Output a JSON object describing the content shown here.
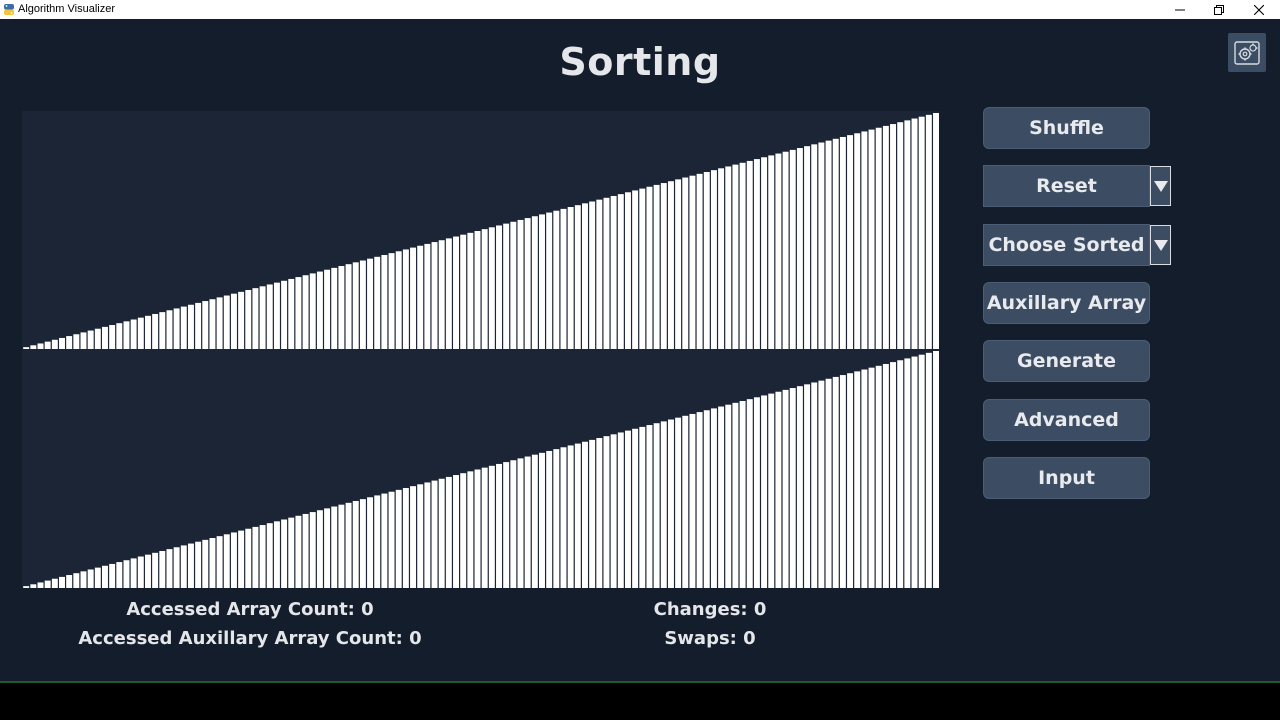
{
  "window": {
    "title": "Algorithm Visualizer"
  },
  "page": {
    "title": "Sorting"
  },
  "icons": {
    "app": "python-icon",
    "settings": "settings-icon",
    "minimize": "minimize-icon",
    "restore": "restore-icon",
    "close": "close-icon",
    "dropdown": "triangle-down-icon"
  },
  "controls": {
    "shuffle": "Shuffle",
    "reset": "Reset",
    "choose_sorted": "Choose Sorted",
    "auxiliary_array": "Auxillary Array",
    "generate": "Generate",
    "advanced": "Advanced",
    "input": "Input"
  },
  "stats": {
    "accessed_array": "Accessed Array Count: 0",
    "accessed_aux_array": "Accessed Auxillary Array Count: 0",
    "changes": "Changes: 0",
    "swaps": "Swaps: 0"
  },
  "arrays": {
    "main": {
      "size": 128,
      "order": "ascending",
      "value_range": [
        1,
        128
      ]
    },
    "auxiliary": {
      "size": 128,
      "order": "ascending",
      "value_range": [
        1,
        128
      ]
    }
  },
  "colors": {
    "background": "#141d2b",
    "panel": "#1b2536",
    "button": "#3c4d63",
    "bar": "#ffffff",
    "text": "#e4e6ea"
  }
}
